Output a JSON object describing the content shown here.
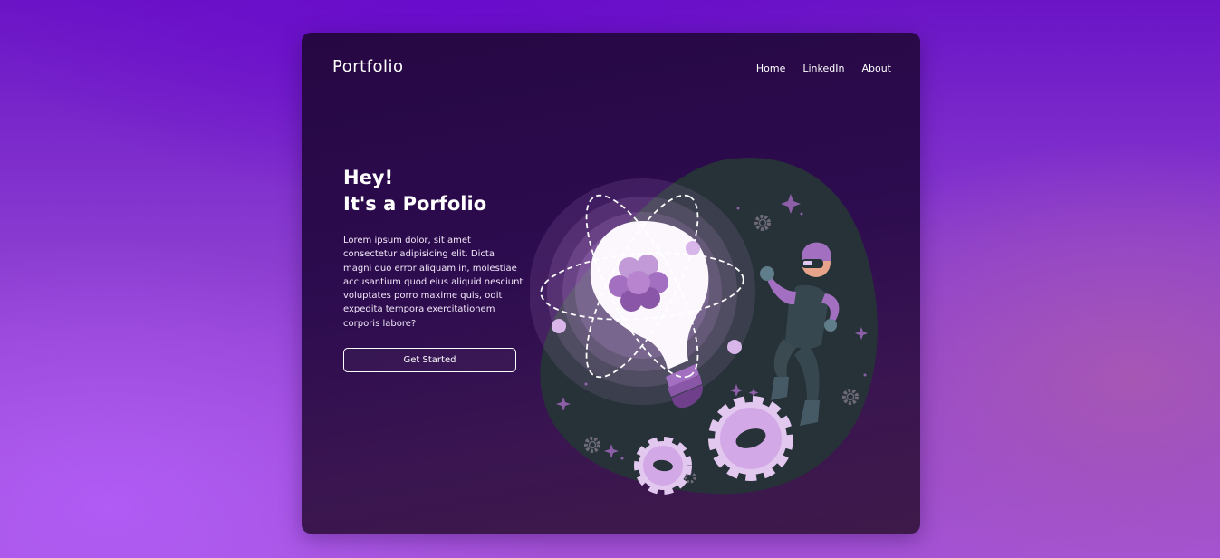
{
  "header": {
    "brand": "Portfolio",
    "nav": [
      "Home",
      "LinkedIn",
      "About"
    ]
  },
  "hero": {
    "title_line1": "Hey!",
    "title_line2": "It's a Porfolio",
    "description": "Lorem ipsum dolor, sit amet consectetur adipisicing elit. Dicta magni quo error aliquam in, molestiae accusantium quod eius aliquid nesciunt voluptates porro maxime quis, odit expedita tempora exercitationem corporis labore?",
    "cta_label": "Get Started"
  },
  "illustration": {
    "name": "idea-lightbulb-vr-person",
    "colors": {
      "blob": "#263238",
      "accent": "#a36fc0",
      "accent_light": "#e2c7ef",
      "bulb": "#f8f2fb"
    }
  }
}
